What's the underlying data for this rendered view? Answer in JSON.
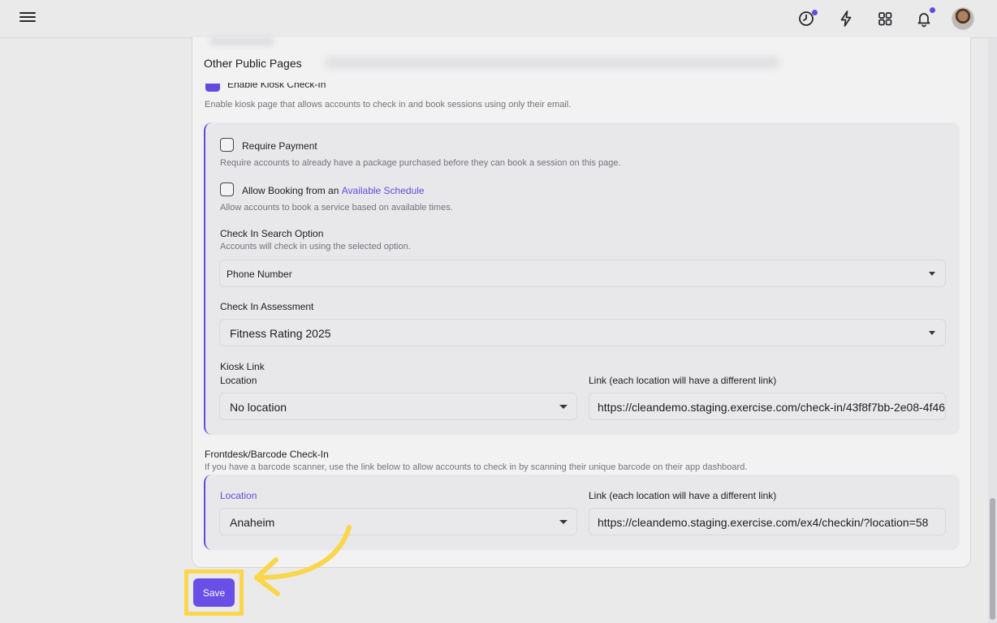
{
  "header": {
    "icons": [
      "menu-icon",
      "clock-icon",
      "lightning-icon",
      "grid-icon",
      "bell-icon",
      "avatar"
    ],
    "accent_dot_color": "#6a4ee8"
  },
  "section": {
    "title": "Other Public Pages",
    "kiosk_toggle_label": "Enable Kiosk Check-In",
    "kiosk_description": "Enable kiosk page that allows accounts to check in and book sessions using only their email."
  },
  "kiosk": {
    "require_payment": {
      "label": "Require Payment",
      "description": "Require accounts to already have a package purchased before they can book a session on this page."
    },
    "allow_booking": {
      "label_prefix": "Allow Booking from an",
      "label_link": "Available Schedule",
      "description": "Allow accounts to book a service based on available times."
    },
    "search_option": {
      "label": "Check In Search Option",
      "description": "Accounts will check in using the selected option.",
      "value": "Phone Number"
    },
    "assessment": {
      "label": "Check In Assessment",
      "value": "Fitness Rating 2025"
    },
    "kiosk_link": {
      "label": "Kiosk Link",
      "location_label": "Location",
      "location_value": "No location",
      "link_label": "Link (each location will have a different link)",
      "link_value": "https://cleandemo.staging.exercise.com/check-in/43f8f7bb-2e08-4f46"
    }
  },
  "frontdesk": {
    "title": "Frontdesk/Barcode Check-In",
    "description": "If you have a barcode scanner, use the link below to allow accounts to check in by scanning their unique barcode on their app dashboard.",
    "location_label": "Location",
    "location_value": "Anaheim",
    "link_label": "Link (each location will have a different link)",
    "link_value": "https://cleandemo.staging.exercise.com/ex4/checkin/?location=58"
  },
  "actions": {
    "save_label": "Save",
    "highlight_color": "#fbd54a",
    "button_color": "#6a4ee8"
  }
}
